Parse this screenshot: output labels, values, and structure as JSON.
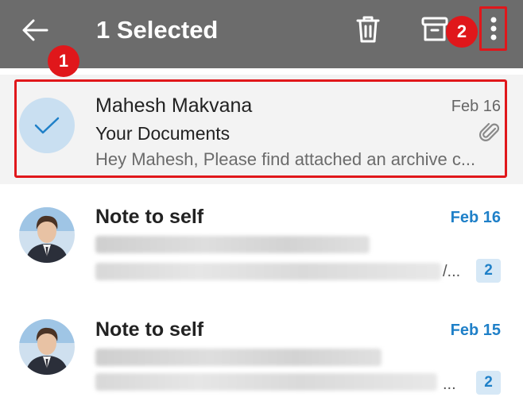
{
  "header": {
    "title": "1 Selected",
    "back_icon": "arrow-left-icon",
    "delete_icon": "trash-icon",
    "archive_icon": "archive-icon",
    "more_icon": "more-vertical-icon"
  },
  "annotations": {
    "step1": "1",
    "step2": "2",
    "color": "#e0171b"
  },
  "emails": [
    {
      "sender": "Mahesh Makvana",
      "date": "Feb 16",
      "subject": "Your Documents",
      "preview": "Hey Mahesh, Please find attached an archive c...",
      "selected": true,
      "has_attachment": true
    },
    {
      "sender": "Note to self",
      "date": "Feb 16",
      "subject_blurred": true,
      "trail": "/...",
      "count": "2",
      "unread": true
    },
    {
      "sender": "Note to self",
      "date": "Feb 15",
      "subject_blurred": true,
      "trail": "...",
      "count": "2",
      "unread": true
    }
  ],
  "colors": {
    "toolbar": "#6c6c6c",
    "accent": "#1f80c8",
    "selected_bg": "#f3f3f3",
    "check_bg": "#c9dff1"
  }
}
